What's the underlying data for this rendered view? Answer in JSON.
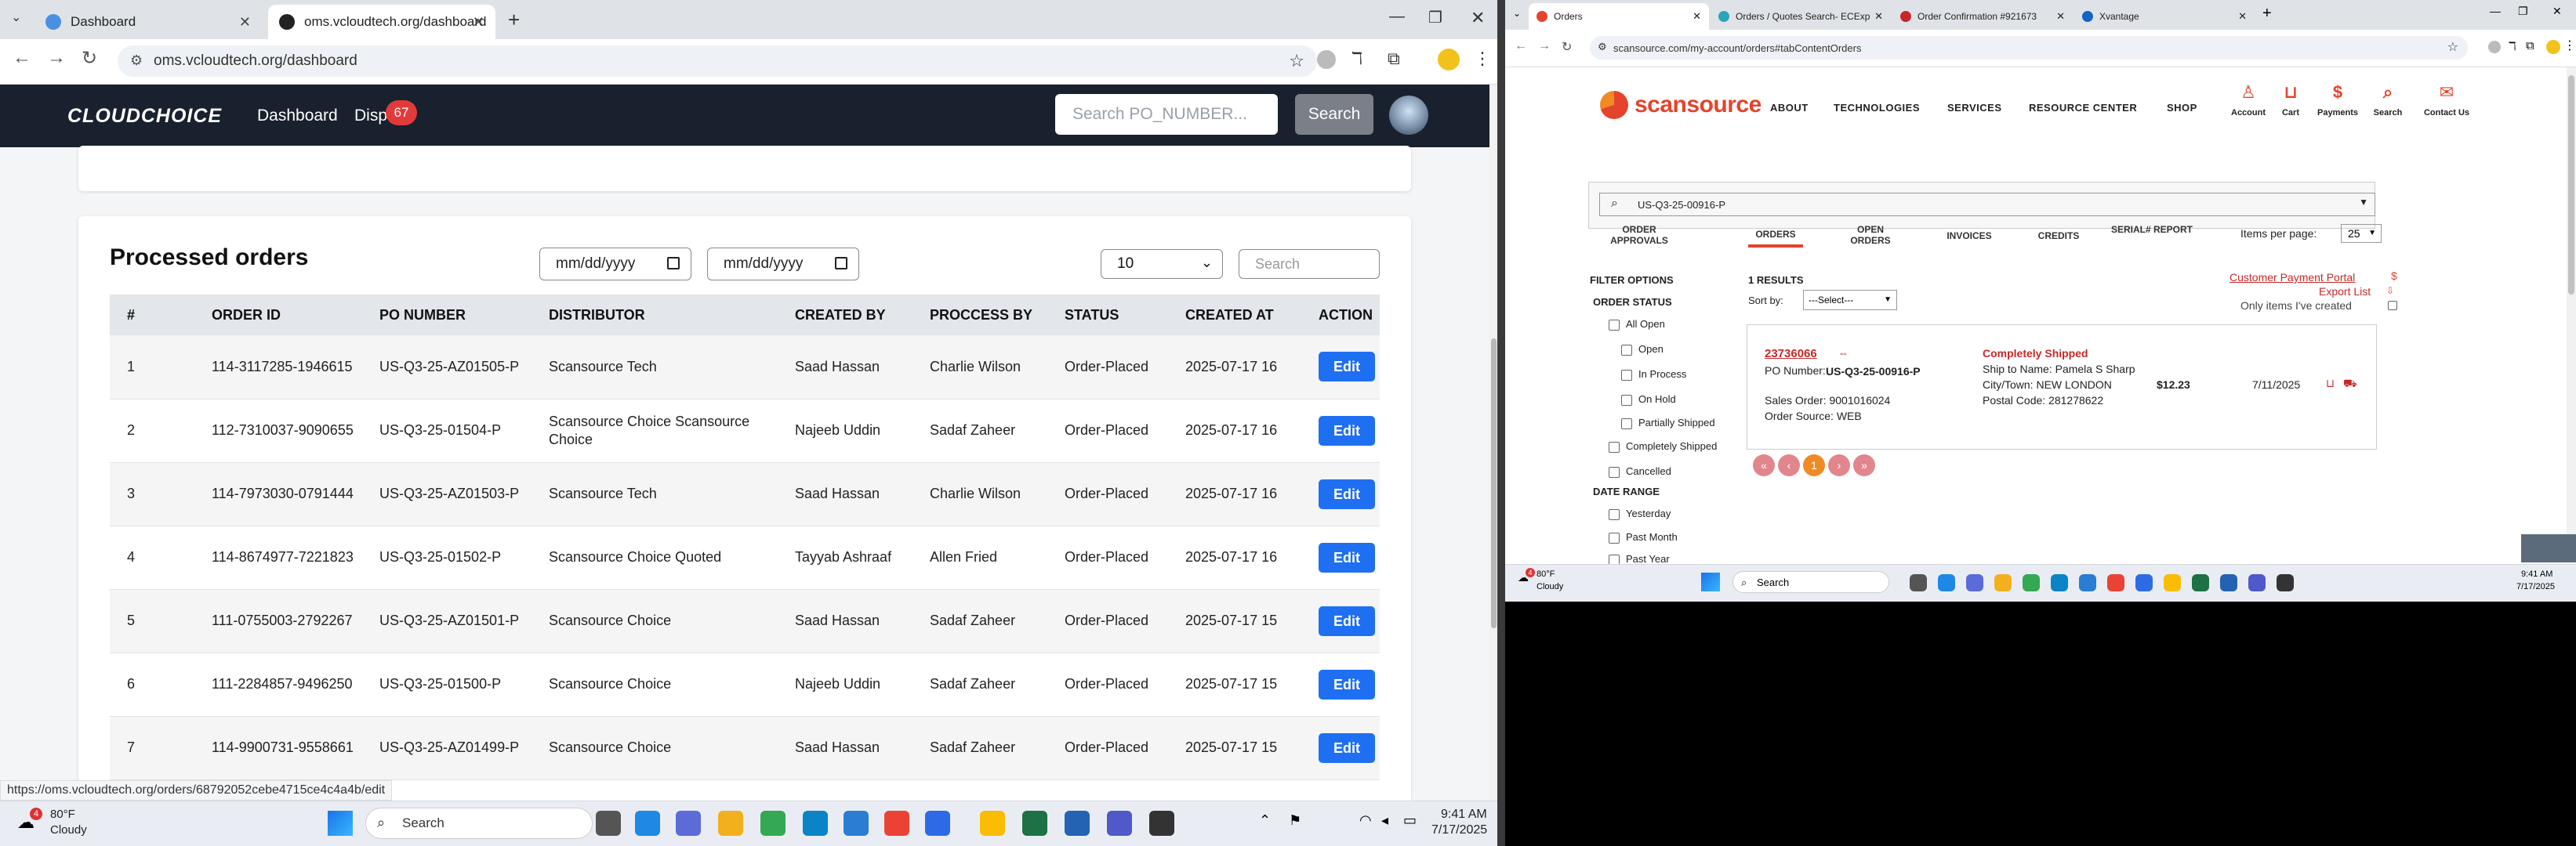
{
  "left": {
    "tabs": [
      {
        "title": "Dashboard",
        "active": false
      },
      {
        "title": "oms.vcloudtech.org/dashboard",
        "active": true
      }
    ],
    "url": "oms.vcloudtech.org/dashboard",
    "header": {
      "logo": "CLOUDCHOICE",
      "nav": [
        "Dashboard",
        "Dispu"
      ],
      "dispute_count": "67",
      "search_placeholder": "Search PO_NUMBER...",
      "search_button": "Search"
    },
    "panel": {
      "title": "Processed orders",
      "date_from": "mm/dd/yyyy",
      "date_to": "mm/dd/yyyy",
      "page_size": "10",
      "search_placeholder": "Search"
    },
    "table": {
      "headers": [
        "#",
        "ORDER ID",
        "PO NUMBER",
        "DISTRIBUTOR",
        "CREATED BY",
        "PROCCESS BY",
        "STATUS",
        "CREATED AT",
        "ACTION"
      ],
      "rows": [
        {
          "n": "1",
          "order_id": "114-3117285-1946615",
          "po": "US-Q3-25-AZ01505-P",
          "distributor": "Scansource Tech",
          "created_by": "Saad Hassan",
          "process_by": "Charlie Wilson",
          "status": "Order-Placed",
          "created_at": "2025-07-17 16",
          "action": "Edit"
        },
        {
          "n": "2",
          "order_id": "112-7310037-9090655",
          "po": "US-Q3-25-01504-P",
          "distributor": "Scansource Choice Scansource Choice",
          "created_by": "Najeeb Uddin",
          "process_by": "Sadaf Zaheer",
          "status": "Order-Placed",
          "created_at": "2025-07-17 16",
          "action": "Edit"
        },
        {
          "n": "3",
          "order_id": "114-7973030-0791444",
          "po": "US-Q3-25-AZ01503-P",
          "distributor": "Scansource Tech",
          "created_by": "Saad Hassan",
          "process_by": "Charlie Wilson",
          "status": "Order-Placed",
          "created_at": "2025-07-17 16",
          "action": "Edit"
        },
        {
          "n": "4",
          "order_id": "114-8674977-7221823",
          "po": "US-Q3-25-01502-P",
          "distributor": "Scansource Choice Quoted",
          "created_by": "Tayyab Ashraaf",
          "process_by": "Allen Fried",
          "status": "Order-Placed",
          "created_at": "2025-07-17 16",
          "action": "Edit"
        },
        {
          "n": "5",
          "order_id": "111-0755003-2792267",
          "po": "US-Q3-25-AZ01501-P",
          "distributor": "Scansource Choice",
          "created_by": "Saad Hassan",
          "process_by": "Sadaf Zaheer",
          "status": "Order-Placed",
          "created_at": "2025-07-17 15",
          "action": "Edit"
        },
        {
          "n": "6",
          "order_id": "111-2284857-9496250",
          "po": "US-Q3-25-01500-P",
          "distributor": "Scansource Choice",
          "created_by": "Najeeb Uddin",
          "process_by": "Sadaf Zaheer",
          "status": "Order-Placed",
          "created_at": "2025-07-17 15",
          "action": "Edit"
        },
        {
          "n": "7",
          "order_id": "114-9900731-9558661",
          "po": "US-Q3-25-AZ01499-P",
          "distributor": "Scansource Choice",
          "created_by": "Saad Hassan",
          "process_by": "Sadaf Zaheer",
          "status": "Order-Placed",
          "created_at": "2025-07-17 15",
          "action": "Edit"
        }
      ]
    },
    "status_url": "https://oms.vcloudtech.org/orders/68792052cebe4715ce4c4a4b/edit",
    "taskbar": {
      "weather_temp": "80°F",
      "weather_desc": "Cloudy",
      "weather_badge": "4",
      "search": "Search",
      "time": "9:41 AM",
      "date": "7/17/2025"
    }
  },
  "right": {
    "tabs": [
      {
        "title": "Orders",
        "active": true
      },
      {
        "title": "Orders / Quotes Search- ECExp",
        "active": false
      },
      {
        "title": "Order Confirmation #921673",
        "active": false
      },
      {
        "title": "Xvantage",
        "active": false
      }
    ],
    "url": "scansource.com/my-account/orders#tabContentOrders",
    "logo": "scansource",
    "nav": [
      "ABOUT",
      "TECHNOLOGIES",
      "SERVICES",
      "RESOURCE CENTER",
      "SHOP"
    ],
    "icons": [
      "Account",
      "Cart",
      "Payments",
      "Search",
      "Contact Us"
    ],
    "search_value": "US-Q3-25-00916-P",
    "tabs_row": [
      "ORDER APPROVALS",
      "ORDERS",
      "OPEN ORDERS",
      "INVOICES",
      "CREDITS",
      "SERIAL# REPORT"
    ],
    "items_per_page_label": "Items per page:",
    "items_per_page": "25",
    "filter_title": "FILTER OPTIONS",
    "order_status_label": "ORDER STATUS",
    "statuses": [
      "All Open",
      "Open",
      "In Process",
      "On Hold",
      "Partially Shipped",
      "Completely Shipped",
      "Cancelled"
    ],
    "date_range_label": "DATE RANGE",
    "date_ranges": [
      "Yesterday",
      "Past Month",
      "Past Year"
    ],
    "results_count": "1 RESULTS",
    "sort_label": "Sort by:",
    "sort_value": "---Select---",
    "customer_portal": "Customer Payment Portal",
    "export_list": "Export List",
    "only_mine": "Only items I've created",
    "result": {
      "order_no": "23736066",
      "po_label": "PO Number:",
      "po": "US-Q3-25-00916-P",
      "sales_order": "Sales Order: 9001016024",
      "order_source": "Order Source: WEB",
      "status": "Completely Shipped",
      "ship_to": "Ship to Name: Pamela S Sharp",
      "city": "City/Town: NEW LONDON",
      "postal": "Postal Code: 281278622",
      "amount": "$12.23",
      "date": "7/11/2025"
    },
    "pager_current": "1",
    "taskbar": {
      "weather_temp": "80°F",
      "weather_desc": "Cloudy",
      "weather_badge": "4",
      "search": "Search",
      "time": "9:41 AM",
      "date": "7/17/2025"
    }
  }
}
